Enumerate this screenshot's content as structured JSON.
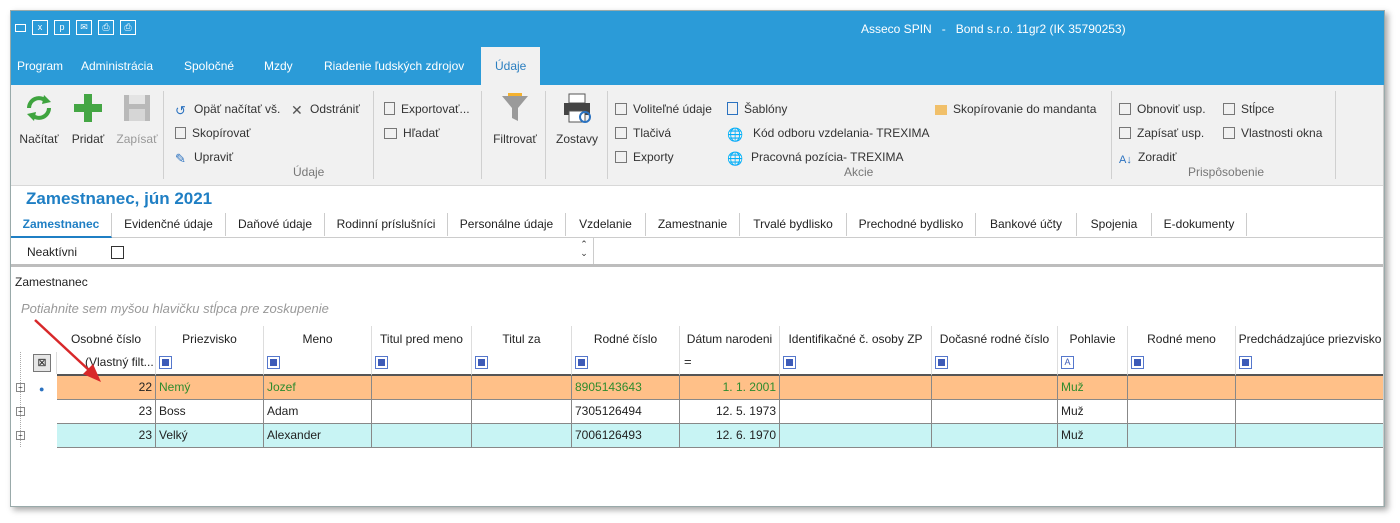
{
  "app": {
    "title": "Asseco SPIN   -   Bond s.r.o. 11gr2 (IK 35790253)"
  },
  "menu": [
    "Program",
    "Administrácia",
    "Spoločné",
    "Mzdy",
    "Riadenie ľudských zdrojov",
    "Údaje"
  ],
  "ribbon": {
    "nacitat": "Načítať",
    "pridat": "Pridať",
    "zapisat": "Zapísať",
    "opat_nacitat": "Opäť načítať vš.",
    "odstranit": "Odstrániť",
    "skopirovat": "Skopírovať",
    "upravit": "Upraviť",
    "exportovat": "Exportovať...",
    "hladat": "Hľadať",
    "group_udaje": "Údaje",
    "filtrovat": "Filtrovať",
    "zostavy": "Zostavy",
    "volitelne": "Voliteľné údaje",
    "tlaciva": "Tlačivá",
    "exporty": "Exporty",
    "sablony": "Šablóny",
    "kod_odboru": "Kód odboru vzdelania- TREXIMA",
    "pracovna": "Pracovná pozícia- TREXIMA",
    "skopirovanie": "Skopírovanie do mandanta",
    "group_akcie": "Akcie",
    "obnovit": "Obnoviť usp.",
    "zapisat_usp": "Zapísať usp.",
    "zoradit": "Zoradiť",
    "stlpce": "Stĺpce",
    "vlastnosti": "Vlastnosti okna",
    "group_prisposobenie": "Prispôsobenie"
  },
  "form_title": "Zamestnanec, jún 2021",
  "tabs": [
    "Zamestnanec",
    "Evidenčné údaje",
    "Daňové údaje",
    "Rodinní príslušníci",
    "Personálne údaje",
    "Vzdelanie",
    "Zamestnanie",
    "Trvalé bydlisko",
    "Prechodné bydlisko",
    "Bankové účty",
    "Spojenia",
    "E-dokumenty"
  ],
  "filter": {
    "neaktivni_label": "Neaktívni"
  },
  "section_label": "Zamestnanec",
  "group_hint": "Potiahnite sem myšou hlavičku stĺpca pre zoskupenie",
  "grid": {
    "columns": [
      "Osobné číslo",
      "Priezvisko",
      "Meno",
      "Titul pred meno",
      "Titul za",
      "Rodné číslo",
      "Dátum narodeni",
      "Identifikačné č. osoby ZP",
      "Dočasné rodné číslo",
      "Pohlavie",
      "Rodné meno",
      "Predchádzajúce priezvisko"
    ],
    "filter_first": "(Vlastný filt...",
    "rows": [
      {
        "osobne": "22",
        "priezvisko": "Nemý",
        "meno": "Jozef",
        "rodne": "8905143643",
        "datum": "1. 1. 2001",
        "pohlavie": "Muž"
      },
      {
        "osobne": "23",
        "priezvisko": "Boss",
        "meno": "Adam",
        "rodne": "7305126494",
        "datum": "12. 5. 1973",
        "pohlavie": "Muž"
      },
      {
        "osobne": "23",
        "priezvisko": "Velký",
        "meno": "Alexander",
        "rodne": "7006126493",
        "datum": "12. 6. 1970",
        "pohlavie": "Muž"
      }
    ]
  },
  "colors": {
    "accent": "#2b9bd8",
    "row_selected": "#ffc088",
    "row_alt": "#c8f4f4",
    "arrow": "#d8282a"
  }
}
